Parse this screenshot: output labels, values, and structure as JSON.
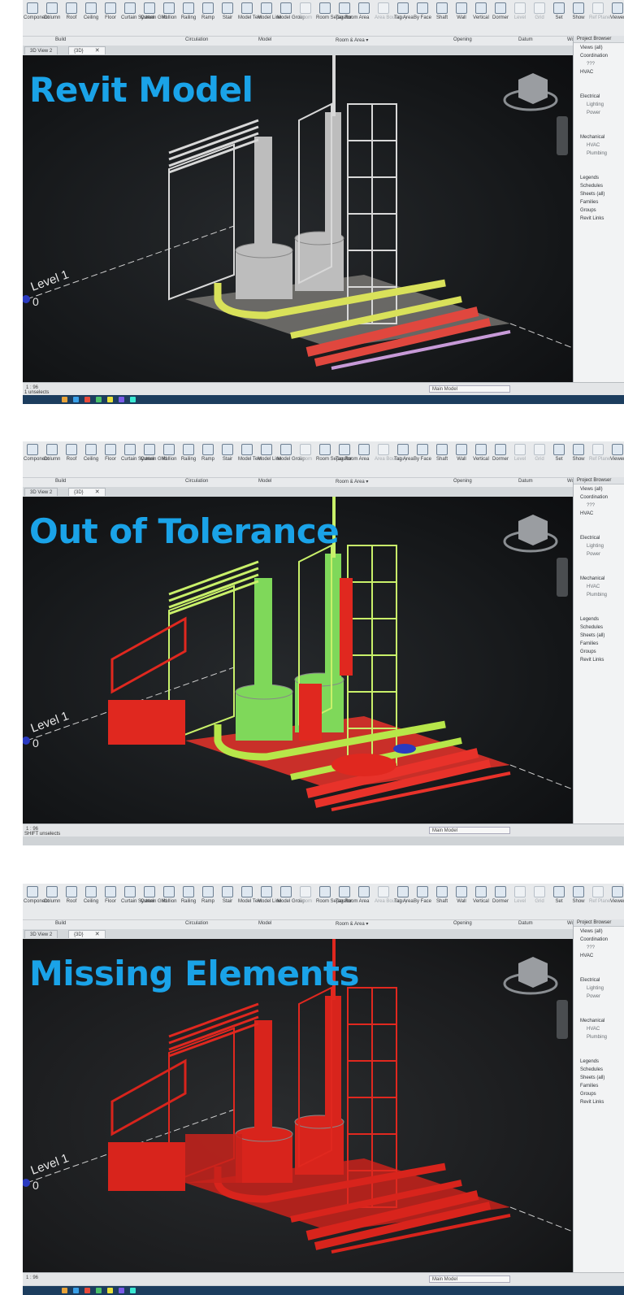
{
  "ribbon": {
    "tools": [
      "Component",
      "Column",
      "Roof",
      "Ceiling",
      "Floor",
      "Curtain System",
      "Curtain Grid",
      "Mullion",
      "Railing",
      "Ramp",
      "Stair",
      "Model Text",
      "Model Line",
      "Model Group",
      "Room",
      "Room Separator",
      "Tag Room",
      "Area",
      "Area Boundary",
      "Tag Area",
      "By Face",
      "Shaft",
      "Wall",
      "Vertical",
      "Dormer",
      "Level",
      "Grid",
      "Set",
      "Show",
      "Ref Plane",
      "Viewer"
    ],
    "dim_tools": [
      "Room",
      "Area Boundary",
      "Level",
      "Grid",
      "Ref Plane"
    ],
    "groups": [
      "Build",
      "Circulation",
      "Model",
      "Room & Area ▾",
      "Opening",
      "Datum",
      "Work Plane"
    ]
  },
  "tabs": [
    "3D View 2",
    "{3D}"
  ],
  "tab_close": "✕",
  "panels": [
    {
      "title": "Revit Model",
      "level_label": "Level 1",
      "level_value": "0",
      "status": "1 unselects",
      "scale": "1 : 96",
      "mode": "color"
    },
    {
      "title": "Out of Tolerance",
      "level_label": "Level 1",
      "level_value": "0",
      "status": "SHIFT unselects",
      "scale": "1 : 96",
      "mode": "heat"
    },
    {
      "title": "Missing Elements",
      "level_label": "Level 1",
      "level_value": "0",
      "status": "",
      "scale": "1 : 96",
      "mode": "red"
    }
  ],
  "project_browser": {
    "header": "Project Browser",
    "items": [
      "Views (all)",
      "Coordination",
      "???",
      "HVAC",
      "Electrical",
      "Lighting",
      "Power",
      "Mechanical",
      "HVAC",
      "Plumbing",
      "Legends",
      "Schedules",
      "Sheets (all)",
      "Families",
      "Groups",
      "Revit Links"
    ]
  },
  "status_bar": {
    "main_model": "Main Model"
  },
  "colors": {
    "title": "#1aa3e8",
    "viewport": "#141618",
    "ribbon": "#e8eaec"
  }
}
